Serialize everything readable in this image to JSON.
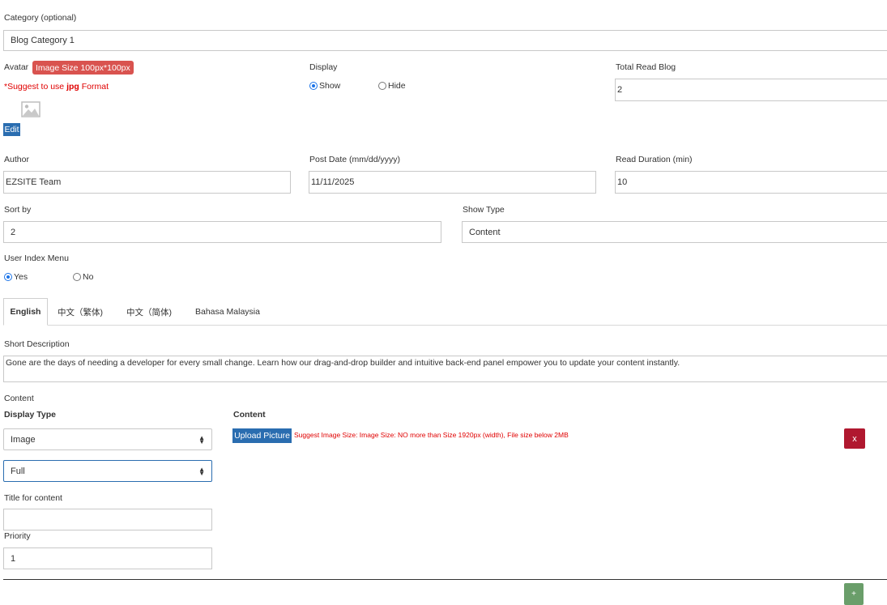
{
  "category": {
    "label": "Category (optional)",
    "value": "Blog Category 1"
  },
  "avatar": {
    "label": "Avatar",
    "size_badge": "Image Size 100px*100px",
    "suggest_prefix": "*Suggest to use ",
    "suggest_format": "jpg",
    "suggest_suffix": " Format",
    "edit_label": "Edit",
    "placeholder_icon": "image-icon"
  },
  "display": {
    "label": "Display",
    "options": [
      "Show",
      "Hide"
    ],
    "selected": "Show"
  },
  "total_read": {
    "label": "Total Read Blog",
    "value": "2"
  },
  "author": {
    "label": "Author",
    "value": "EZSITE Team"
  },
  "post_date": {
    "label": "Post Date (mm/dd/yyyy)",
    "value": "11/11/2025"
  },
  "read_duration": {
    "label": "Read Duration (min)",
    "value": "10"
  },
  "sort_by": {
    "label": "Sort by",
    "value": "2"
  },
  "show_type": {
    "label": "Show Type",
    "value": "Content"
  },
  "user_index_menu": {
    "label": "User Index Menu",
    "options": [
      "Yes",
      "No"
    ],
    "selected": "Yes"
  },
  "tabs": [
    "English",
    "中文（繁体)",
    "中文（简体)",
    "Bahasa Malaysia"
  ],
  "active_tab": "English",
  "short_description": {
    "label": "Short Description",
    "value": "Gone are the days of needing a developer for every small change. Learn how our drag-and-drop builder and intuitive back-end panel empower you to update your content instantly."
  },
  "content_section": {
    "label": "Content",
    "display_type_label": "Display Type",
    "display_type_value": "Image",
    "size_value": "Full",
    "title_label": "Title for content",
    "title_value": "",
    "priority_label": "Priority",
    "priority_value": "1",
    "content_label": "Content",
    "upload_label": "Upload Picture",
    "upload_hint": "Suggest Image Size: Image Size: NO more than Size 1920px (width), File size below 2MB",
    "remove_label": "x",
    "add_label": "+"
  },
  "colors": {
    "accent_blue": "#2a6db0",
    "badge_red": "#d9534f",
    "danger": "#b0182f",
    "hint_red": "#e00000",
    "add_green": "#6a9e6a"
  }
}
